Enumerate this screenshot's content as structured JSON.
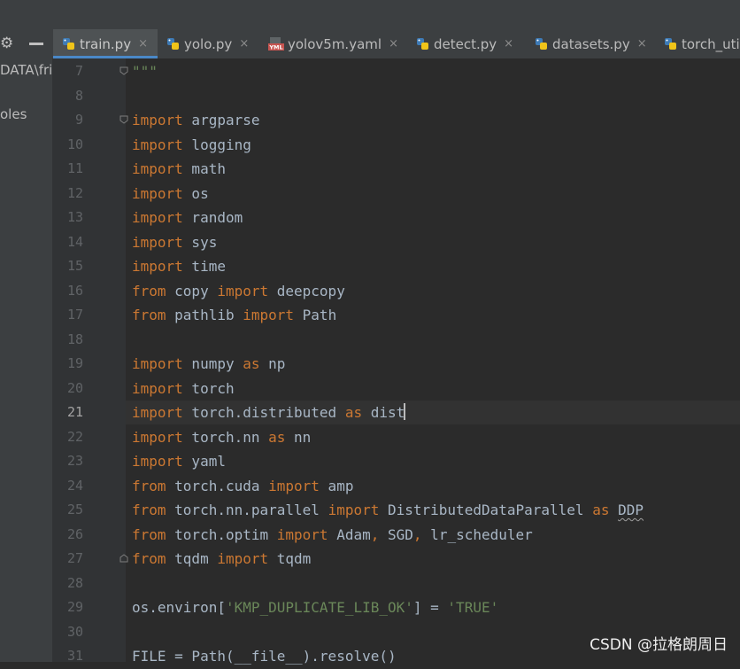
{
  "tabs": [
    {
      "label": "train.py",
      "icon": "python-file-icon",
      "active": true
    },
    {
      "label": "yolo.py",
      "icon": "python-file-icon"
    },
    {
      "label": "yolov5m.yaml",
      "icon": "yaml-file-icon"
    },
    {
      "label": "detect.py",
      "icon": "python-file-icon"
    },
    {
      "label": "datasets.py",
      "icon": "python-file-icon"
    },
    {
      "label": "torch_uti",
      "icon": "python-file-icon"
    }
  ],
  "close_glyph": "×",
  "sidebar": {
    "path_text": "DATA\\fri",
    "item_text": "oles"
  },
  "editor": {
    "current_line": 21,
    "lines": [
      {
        "n": 7,
        "segs": [
          {
            "t": "\"\"\"",
            "c": "str"
          }
        ]
      },
      {
        "n": 8,
        "segs": []
      },
      {
        "n": 9,
        "segs": [
          {
            "t": "import",
            "c": "kw"
          },
          {
            "t": " argparse"
          }
        ]
      },
      {
        "n": 10,
        "segs": [
          {
            "t": "import",
            "c": "kw"
          },
          {
            "t": " logging"
          }
        ]
      },
      {
        "n": 11,
        "segs": [
          {
            "t": "import",
            "c": "kw"
          },
          {
            "t": " math"
          }
        ]
      },
      {
        "n": 12,
        "segs": [
          {
            "t": "import",
            "c": "kw"
          },
          {
            "t": " os"
          }
        ]
      },
      {
        "n": 13,
        "segs": [
          {
            "t": "import",
            "c": "kw"
          },
          {
            "t": " random"
          }
        ]
      },
      {
        "n": 14,
        "segs": [
          {
            "t": "import",
            "c": "kw"
          },
          {
            "t": " sys"
          }
        ]
      },
      {
        "n": 15,
        "segs": [
          {
            "t": "import",
            "c": "kw"
          },
          {
            "t": " time"
          }
        ]
      },
      {
        "n": 16,
        "segs": [
          {
            "t": "from",
            "c": "kw"
          },
          {
            "t": " copy "
          },
          {
            "t": "import",
            "c": "kw"
          },
          {
            "t": " deepcopy"
          }
        ]
      },
      {
        "n": 17,
        "segs": [
          {
            "t": "from",
            "c": "kw"
          },
          {
            "t": " pathlib "
          },
          {
            "t": "import",
            "c": "kw"
          },
          {
            "t": " Path"
          }
        ]
      },
      {
        "n": 18,
        "segs": []
      },
      {
        "n": 19,
        "segs": [
          {
            "t": "import",
            "c": "kw"
          },
          {
            "t": " numpy "
          },
          {
            "t": "as",
            "c": "kw"
          },
          {
            "t": " np"
          }
        ]
      },
      {
        "n": 20,
        "segs": [
          {
            "t": "import",
            "c": "kw"
          },
          {
            "t": " torch"
          }
        ]
      },
      {
        "n": 21,
        "segs": [
          {
            "t": "import",
            "c": "kw"
          },
          {
            "t": " torch.distributed "
          },
          {
            "t": "as",
            "c": "kw"
          },
          {
            "t": " dist"
          }
        ]
      },
      {
        "n": 22,
        "segs": [
          {
            "t": "import",
            "c": "kw"
          },
          {
            "t": " torch.nn "
          },
          {
            "t": "as",
            "c": "kw"
          },
          {
            "t": " nn"
          }
        ]
      },
      {
        "n": 23,
        "segs": [
          {
            "t": "import",
            "c": "kw"
          },
          {
            "t": " yaml"
          }
        ]
      },
      {
        "n": 24,
        "segs": [
          {
            "t": "from",
            "c": "kw"
          },
          {
            "t": " torch.cuda "
          },
          {
            "t": "import",
            "c": "kw"
          },
          {
            "t": " amp"
          }
        ]
      },
      {
        "n": 25,
        "segs": [
          {
            "t": "from",
            "c": "kw"
          },
          {
            "t": " torch.nn.parallel "
          },
          {
            "t": "import",
            "c": "kw"
          },
          {
            "t": " DistributedDataParallel "
          },
          {
            "t": "as",
            "c": "kw"
          },
          {
            "t": " "
          },
          {
            "t": "DDP",
            "c": "wavy"
          }
        ]
      },
      {
        "n": 26,
        "segs": [
          {
            "t": "from",
            "c": "kw"
          },
          {
            "t": " torch.optim "
          },
          {
            "t": "import",
            "c": "kw"
          },
          {
            "t": " Adam"
          },
          {
            "t": ",",
            "c": "kw"
          },
          {
            "t": " SGD"
          },
          {
            "t": ",",
            "c": "kw"
          },
          {
            "t": " lr_scheduler"
          }
        ]
      },
      {
        "n": 27,
        "segs": [
          {
            "t": "from",
            "c": "kw"
          },
          {
            "t": " tqdm "
          },
          {
            "t": "import",
            "c": "kw"
          },
          {
            "t": " tqdm"
          }
        ]
      },
      {
        "n": 28,
        "segs": []
      },
      {
        "n": 29,
        "segs": [
          {
            "t": "os.environ["
          },
          {
            "t": "'KMP_DUPLICATE_LIB_OK'",
            "c": "str"
          },
          {
            "t": "] = "
          },
          {
            "t": "'TRUE'",
            "c": "str"
          }
        ]
      },
      {
        "n": 30,
        "segs": []
      },
      {
        "n": 31,
        "segs": [
          {
            "t": "FILE = Path(__file__).resolve()"
          }
        ]
      }
    ]
  },
  "watermark": "CSDN @拉格朗周日"
}
